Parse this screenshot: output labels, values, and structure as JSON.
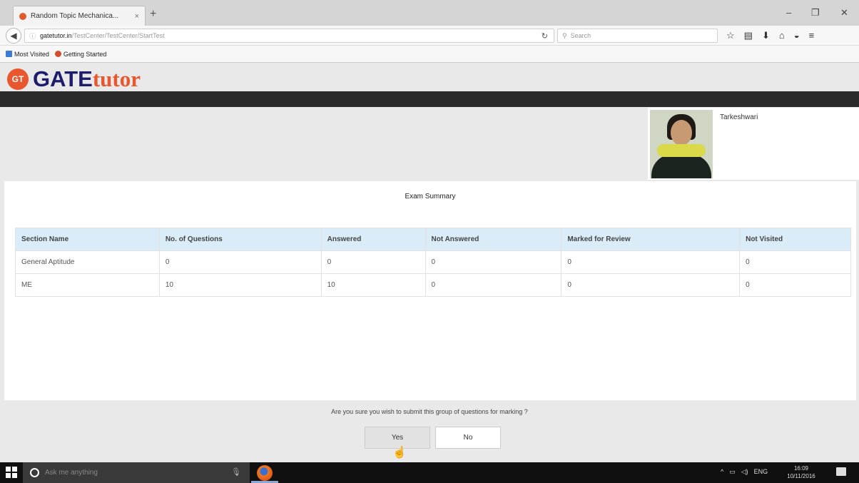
{
  "browser": {
    "tab_title": "Random Topic Mechanica...",
    "tab_close": "×",
    "new_tab": "+",
    "window_controls": {
      "minimize": "–",
      "restore": "❐",
      "close": "✕"
    },
    "url_host": "gatetutor.in",
    "url_path": "/TestCenter/TestCenter/StartTest",
    "search_placeholder": "Search",
    "bookmarks": [
      "Most Visited",
      "Getting Started"
    ]
  },
  "site": {
    "logo_badge": "GT",
    "logo_gate": "GATE",
    "logo_tutor": "tutor"
  },
  "candidate": {
    "name": "Tarkeshwari"
  },
  "summary": {
    "title": "Exam Summary",
    "columns": [
      "Section Name",
      "No. of Questions",
      "Answered",
      "Not Answered",
      "Marked for Review",
      "Not Visited"
    ],
    "rows": [
      [
        "General Aptitude",
        "0",
        "0",
        "0",
        "0",
        "0"
      ],
      [
        "ME",
        "10",
        "10",
        "0",
        "0",
        "0"
      ]
    ]
  },
  "confirm": {
    "question": "Are you sure you wish to submit this group of questions for marking ?",
    "yes_label": "Yes",
    "no_label": "No"
  },
  "taskbar": {
    "cortana_placeholder": "Ask me anything",
    "lang": "ENG",
    "time": "16:09",
    "date": "10/11/2016"
  }
}
